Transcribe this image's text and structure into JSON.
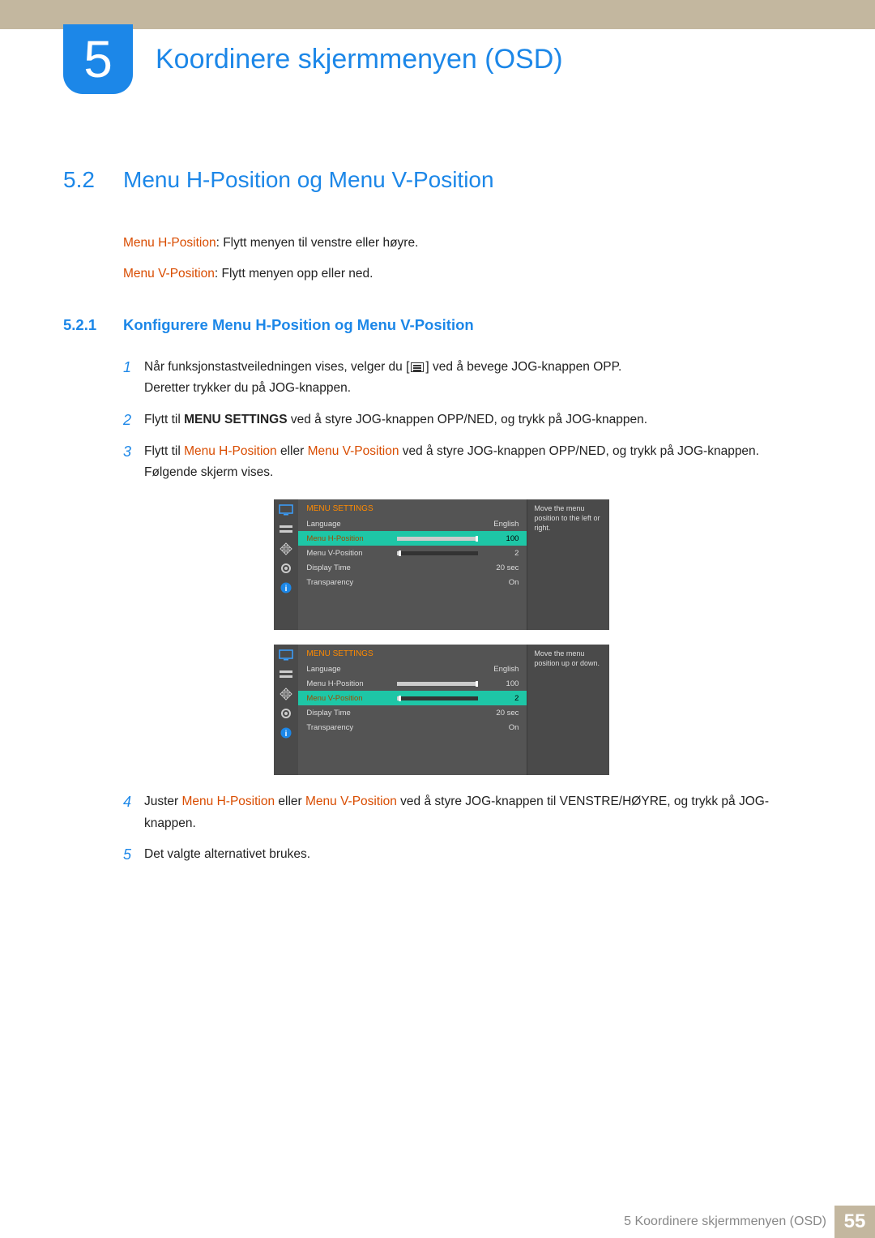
{
  "chapter": {
    "number": "5",
    "title": "Koordinere skjermmenyen (OSD)"
  },
  "section": {
    "number": "5.2",
    "title": "Menu H-Position og Menu V-Position"
  },
  "intro": {
    "h_label": "Menu H-Position",
    "h_desc": ": Flytt menyen til venstre eller høyre.",
    "v_label": "Menu V-Position",
    "v_desc": ": Flytt menyen opp eller ned."
  },
  "subsection": {
    "number": "5.2.1",
    "title": "Konfigurere Menu H-Position og Menu V-Position"
  },
  "steps": {
    "s1": {
      "num": "1",
      "a": "Når funksjonstastveiledningen vises, velger du [",
      "b": "] ved å bevege JOG-knappen OPP.",
      "c": "Deretter trykker du på JOG-knappen."
    },
    "s2": {
      "num": "2",
      "a": "Flytt til ",
      "b": "MENU SETTINGS",
      "c": " ved å styre JOG-knappen OPP/NED, og trykk på JOG-knappen."
    },
    "s3": {
      "num": "3",
      "a": "Flytt til ",
      "b": "Menu H-Position",
      "c": " eller ",
      "d": "Menu V-Position",
      "e": " ved å styre JOG-knappen OPP/NED, og trykk på JOG-knappen. Følgende skjerm vises."
    },
    "s4": {
      "num": "4",
      "a": "Juster ",
      "b": "Menu H-Position",
      "c": " eller ",
      "d": "Menu V-Position",
      "e": " ved å styre JOG-knappen til VENSTRE/HØYRE, og trykk på JOG-knappen."
    },
    "s5": {
      "num": "5",
      "a": "Det valgte alternativet brukes."
    }
  },
  "osd1": {
    "title": "MENU SETTINGS",
    "help": "Move the menu position to the left or right.",
    "rows": {
      "lang": {
        "label": "Language",
        "value": "English"
      },
      "hpos": {
        "label": "Menu H-Position",
        "value": "100",
        "pct": 100
      },
      "vpos": {
        "label": "Menu V-Position",
        "value": "2",
        "pct": 2
      },
      "dtime": {
        "label": "Display Time",
        "value": "20 sec"
      },
      "trans": {
        "label": "Transparency",
        "value": "On"
      }
    }
  },
  "osd2": {
    "title": "MENU SETTINGS",
    "help": "Move the menu position up or down.",
    "rows": {
      "lang": {
        "label": "Language",
        "value": "English"
      },
      "hpos": {
        "label": "Menu H-Position",
        "value": "100",
        "pct": 100
      },
      "vpos": {
        "label": "Menu V-Position",
        "value": "2",
        "pct": 2
      },
      "dtime": {
        "label": "Display Time",
        "value": "20 sec"
      },
      "trans": {
        "label": "Transparency",
        "value": "On"
      }
    }
  },
  "footer": {
    "text": "5 Koordinere skjermmenyen (OSD)",
    "page": "55"
  }
}
